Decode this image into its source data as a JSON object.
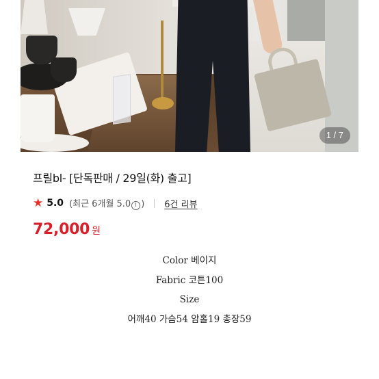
{
  "gallery": {
    "counter": "1 / 7",
    "photo_subject": "product-photo"
  },
  "product": {
    "title": "프릴bl- [단독판매 / 29일(화) 출고]",
    "rating": {
      "score": "5.0",
      "recent_prefix": "(최근 6개월 5.0",
      "info_glyph": "i",
      "recent_suffix": ")",
      "reviews_link": "6건 리뷰"
    },
    "price": "72,000",
    "currency": "원"
  },
  "description": {
    "lines": [
      "Color 베이지",
      "Fabric 코튼100",
      "Size",
      "어깨40 가슴54 암홀19 총장59"
    ]
  },
  "colors": {
    "price": "#d7202a",
    "star": "#e9302b"
  }
}
